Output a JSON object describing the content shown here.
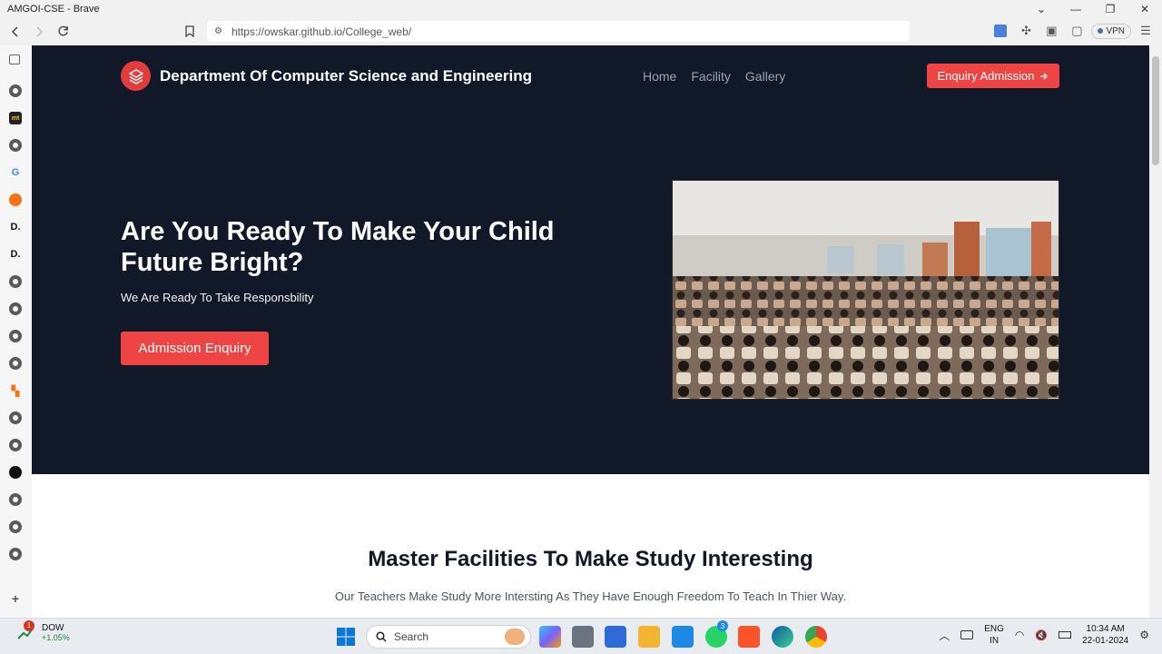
{
  "window": {
    "title": "AMGOI-CSE - Brave"
  },
  "browser": {
    "url": "https://owskar.github.io/College_web/",
    "vpn_label": "VPN"
  },
  "site": {
    "brand": "Department Of Computer Science and Engineering",
    "nav": [
      "Home",
      "Facility",
      "Gallery"
    ],
    "cta_top": "Enquiry Admission",
    "hero_title": "Are You Ready To Make Your Child Future Bright?",
    "hero_subtitle": "We Are Ready To Take Responsbility",
    "hero_button": "Admission Enquiry",
    "section_title": "Master Facilities To Make Study Interesting",
    "section_subtitle": "Our Teachers Make Study More Intersting As They Have Enough Freedom To Teach In Thier Way."
  },
  "taskbar": {
    "weather_title": "DOW",
    "weather_value": "+1.05%",
    "weather_badge": "1",
    "search_placeholder": "Search",
    "lang_line1": "ENG",
    "lang_line2": "IN",
    "time": "10:34 AM",
    "date": "22-01-2024",
    "whatsapp_badge": "3"
  },
  "colors": {
    "hero_bg": "#111827",
    "accent": "#ef4444"
  }
}
